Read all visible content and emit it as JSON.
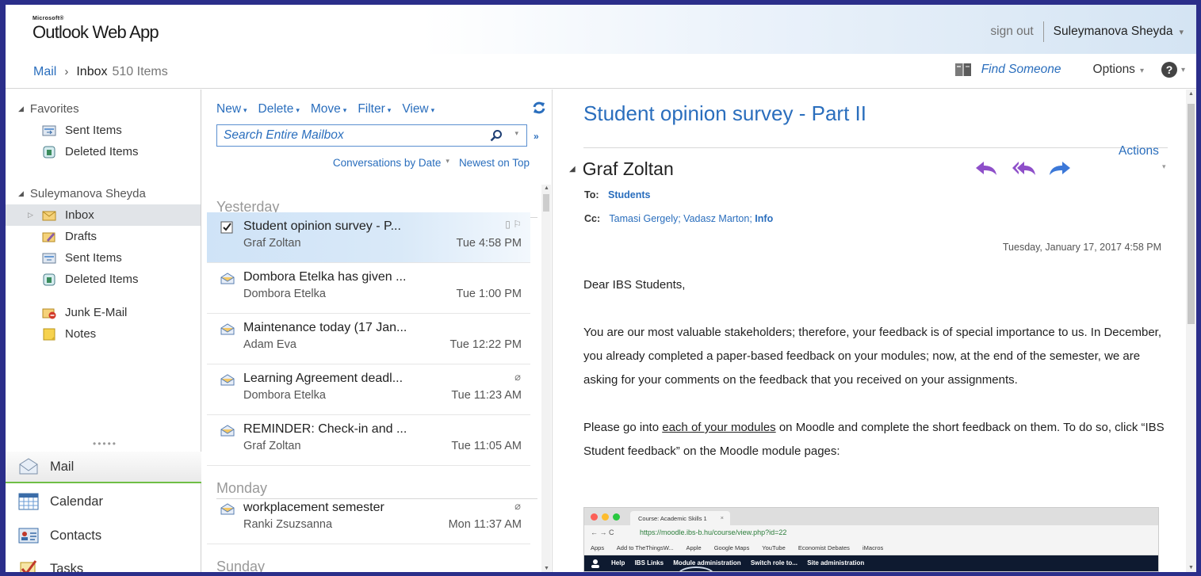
{
  "header": {
    "brand_small": "Microsoft®",
    "app_name": "Outlook Web App",
    "sign_out": "sign out",
    "user_name": "Suleymanova Sheyda"
  },
  "breadcrumb": {
    "mail": "Mail",
    "separator": "›",
    "folder": "Inbox",
    "count": "510 Items"
  },
  "tools": {
    "find_someone": "Find Someone",
    "options": "Options",
    "help": "?"
  },
  "nav": {
    "favorites_label": "Favorites",
    "favorites": [
      {
        "label": "Sent Items",
        "icon": "sent-items-icon"
      },
      {
        "label": "Deleted Items",
        "icon": "deleted-items-icon"
      }
    ],
    "mailbox_label": "Suleymanova Sheyda",
    "folders": [
      {
        "label": "Inbox",
        "icon": "inbox-icon",
        "selected": true
      },
      {
        "label": "Drafts",
        "icon": "drafts-icon"
      },
      {
        "label": "Sent Items",
        "icon": "sent-items-icon"
      },
      {
        "label": "Deleted Items",
        "icon": "deleted-items-icon"
      },
      {
        "label": "Junk E-Mail",
        "icon": "junk-icon"
      },
      {
        "label": "Notes",
        "icon": "notes-icon"
      }
    ],
    "modules": [
      {
        "label": "Mail",
        "icon": "mail-icon",
        "active": true
      },
      {
        "label": "Calendar",
        "icon": "calendar-icon"
      },
      {
        "label": "Contacts",
        "icon": "contacts-icon"
      },
      {
        "label": "Tasks",
        "icon": "tasks-icon"
      }
    ]
  },
  "list": {
    "toolbar": [
      "New",
      "Delete",
      "Move",
      "Filter",
      "View"
    ],
    "search_placeholder": "Search Entire Mailbox",
    "sort_by": "Conversations by Date",
    "sort_order": "Newest on Top",
    "groups": [
      "Yesterday",
      "Monday",
      "Sunday"
    ],
    "messages": [
      {
        "subject": "Student opinion survey - P...",
        "from": "Graf Zoltan",
        "time": "Tue 4:58 PM",
        "selected": true
      },
      {
        "subject": "Dombora Etelka has given ...",
        "from": "Dombora Etelka",
        "time": "Tue 1:00 PM"
      },
      {
        "subject": "Maintenance today (17 Jan...",
        "from": "Adam Eva",
        "time": "Tue 12:22 PM"
      },
      {
        "subject": "Learning Agreement deadl...",
        "from": "Dombora Etelka",
        "time": "Tue 11:23 AM",
        "attachment": true
      },
      {
        "subject": "REMINDER: Check-in and ...",
        "from": "Graf Zoltan",
        "time": "Tue 11:05 AM"
      },
      {
        "subject": "workplacement semester",
        "from": "Ranki Zsuzsanna",
        "time": "Mon 11:37 AM",
        "attachment": true
      }
    ]
  },
  "reading": {
    "subject": "Student opinion survey - Part II",
    "actions": "Actions",
    "sender": "Graf Zoltan",
    "to_label": "To:",
    "to": "Students",
    "cc_label": "Cc:",
    "cc_plain": "Tamasi Gergely; Vadasz Marton;",
    "cc_bold": "Info",
    "date": "Tuesday, January 17, 2017 4:58 PM",
    "greeting": "Dear IBS Students,",
    "para1": "You are our most valuable stakeholders; therefore, your feedback is of special importance to us. In December, you already completed a paper-based feedback on your modules; now, at the end of the semester, we are asking for your comments on the feedback that you received on your assignments.",
    "para2_a": "Please go into ",
    "para2_link": "each of your modules",
    "para2_b": " on Moodle and complete the short feedback on them. To do so, click “IBS Student feedback” on the Moodle module pages:",
    "embed": {
      "tab": "Course: Academic Skills 1",
      "tab_close": "×",
      "nav": "←  →  C",
      "url": "https://moodle.ibs-b.hu/course/view.php?id=22",
      "bookmarks": [
        "Apps",
        "Add to TheThingsW...",
        "Apple",
        "Google Maps",
        "YouTube",
        "Economist Debates",
        "iMacros"
      ],
      "admin": [
        "Help",
        "IBS Links",
        "Module administration",
        "Switch role to...",
        "Site administration"
      ]
    }
  }
}
